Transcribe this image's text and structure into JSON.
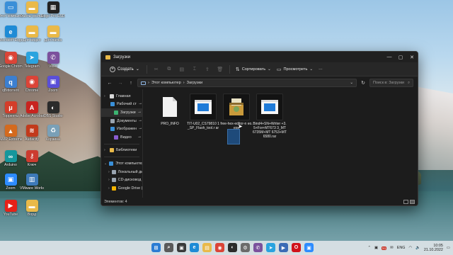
{
  "desktop": {
    "icons": [
      {
        "label": "Этот компьютер",
        "icon": "computer-icon",
        "color": "#3a8fd8"
      },
      {
        "label": "Файлы фильмы",
        "icon": "folder-icon",
        "color": "#e9b949"
      },
      {
        "label": "Edge Pro ESD.exe",
        "icon": "film-icon",
        "color": "#222222"
      },
      {
        "label": "Microsoft Edge",
        "icon": "edge-icon",
        "color": "#1e8bd6"
      },
      {
        "label": "Для видео",
        "icon": "folder-icon",
        "color": "#e9b949"
      },
      {
        "label": "Доп.папка",
        "icon": "folder-icon",
        "color": "#e9b949"
      },
      {
        "label": "Google Chrome",
        "icon": "chrome-icon",
        "color": "#db4437"
      },
      {
        "label": "Telegram",
        "icon": "telegram-icon",
        "color": "#2aa3df"
      },
      {
        "label": "Viber",
        "icon": "viber-icon",
        "color": "#7b519d"
      },
      {
        "label": "qBittorrent",
        "icon": "qbittorrent-icon",
        "color": "#3c7fd0"
      },
      {
        "label": "Chrome",
        "icon": "chrome-icon",
        "color": "#db4437"
      },
      {
        "label": "Zoom",
        "icon": "zoom-icon",
        "color": "#5a4fd8"
      },
      {
        "label": "Торренты",
        "icon": "torrent-icon",
        "color": "#d43d2a"
      },
      {
        "label": "Adobe Acrobat",
        "icon": "acrobat-icon",
        "color": "#c8231f"
      },
      {
        "label": "OBS Studio",
        "icon": "obs-icon",
        "color": "#2b2b2b"
      },
      {
        "label": "AIMP Extreme",
        "icon": "aimp-icon",
        "color": "#d46a1e"
      },
      {
        "label": "Audacity",
        "icon": "audacity-icon",
        "color": "#c23a1c"
      },
      {
        "label": "Корзина",
        "icon": "recycle-bin-icon",
        "color": "#7aa0b7"
      },
      {
        "label": "Arduino",
        "icon": "arduino-icon",
        "color": "#15979c"
      },
      {
        "label": "Ключ",
        "icon": "key-icon",
        "color": "#cc3b2f"
      },
      {
        "label": "Zoom",
        "icon": "zoom-icon",
        "color": "#2d8cff"
      },
      {
        "label": "VMware Workstati...",
        "icon": "vmware-icon",
        "color": "#3d79b8"
      },
      {
        "label": "YouTube",
        "icon": "youtube-icon",
        "color": "#e62117"
      },
      {
        "label": "Ворд",
        "icon": "folder-icon",
        "color": "#e9b949"
      }
    ]
  },
  "window": {
    "title": "Загрузки",
    "create_label": "Создать",
    "sort_label": "Сортировать",
    "view_label": "Просмотреть",
    "more_label": "···",
    "address": {
      "root": "Этот компьютер",
      "current": "Загрузки"
    },
    "search_placeholder": "Поиск в: Загрузки",
    "sidebar": [
      {
        "label": "Главная",
        "icon": "home-icon",
        "color": "#d9d9d9",
        "level": 0,
        "chev": "›"
      },
      {
        "label": "Рабочий ст",
        "icon": "desktop-icon",
        "color": "#3a8fd8",
        "level": 1,
        "pin": "📌"
      },
      {
        "label": "Загрузки",
        "icon": "download-icon",
        "color": "#3cb371",
        "level": 1,
        "pin": "📌",
        "selected": true
      },
      {
        "label": "Документы",
        "icon": "document-icon",
        "color": "#9aa5b1",
        "level": 1,
        "pin": "📌"
      },
      {
        "label": "Изображен",
        "icon": "image-icon",
        "color": "#3a8fd8",
        "level": 1,
        "pin": "📌"
      },
      {
        "label": "Видео",
        "icon": "video-icon",
        "color": "#8a5cd0",
        "level": 1,
        "pin": "📌"
      },
      {
        "label": "Библиотеки",
        "icon": "library-icon",
        "color": "#e9b949",
        "level": 0,
        "chev": "›",
        "divider_before": true
      },
      {
        "label": "Этот компьютер",
        "icon": "computer-icon",
        "color": "#3a8fd8",
        "level": 0,
        "chev": "⌄",
        "divider_before": true
      },
      {
        "label": "Локальный ди",
        "icon": "drive-icon",
        "color": "#9aa5b1",
        "level": 1,
        "chev": "›"
      },
      {
        "label": "CD-дисковод (",
        "icon": "cd-icon",
        "color": "#9aa5b1",
        "level": 1,
        "chev": "›"
      },
      {
        "label": "Google Drive (",
        "icon": "google-drive-icon",
        "color": "#f4b400",
        "level": 1,
        "chev": "›"
      }
    ],
    "files": [
      {
        "name": "PRO_INFO",
        "icon": "blank-file-icon"
      },
      {
        "name": "TIT-U02_CS79810 1_SP_Flash_tool.r ar",
        "icon": "app-window-icon"
      },
      {
        "name": "free-hex-editor-n eo.exe",
        "icon": "installer-icon"
      },
      {
        "name": "Bind4+SN+Writer +3.5+For+MT673 3_MT6735M+MT 6753+MT6580.rar",
        "icon": "app-window-icon"
      }
    ],
    "status": "Элементов: 4"
  },
  "taskbar": {
    "apps": [
      {
        "icon": "start-icon",
        "color": "#2b7cd3",
        "glyph": "⊞"
      },
      {
        "icon": "search-icon",
        "color": "#5a5a5a",
        "glyph": "⌕"
      },
      {
        "icon": "task-view-icon",
        "color": "#3a3a3a",
        "glyph": "▣"
      },
      {
        "icon": "edge-icon",
        "color": "#1e8bd6",
        "glyph": "e"
      },
      {
        "icon": "file-explorer-icon",
        "color": "#e9b949",
        "glyph": "▤"
      },
      {
        "icon": "chrome-icon",
        "color": "#db4437",
        "glyph": "◉"
      },
      {
        "icon": "obs-icon",
        "color": "#2b2b2b",
        "glyph": "◐"
      },
      {
        "icon": "settings-icon",
        "color": "#6b6b6b",
        "glyph": "⚙"
      },
      {
        "icon": "viber-icon",
        "color": "#7b519d",
        "glyph": "✆"
      },
      {
        "icon": "telegram-icon",
        "color": "#2aa3df",
        "glyph": "➤"
      },
      {
        "icon": "media-icon",
        "color": "#3a6bb5",
        "glyph": "▶"
      },
      {
        "icon": "opera-icon",
        "color": "#d0121b",
        "glyph": "O"
      },
      {
        "icon": "zoom-icon",
        "color": "#2d8cff",
        "glyph": "▣"
      }
    ],
    "badge": "51",
    "language": "ENG",
    "time": "10:05",
    "date": "21.10.2022"
  }
}
